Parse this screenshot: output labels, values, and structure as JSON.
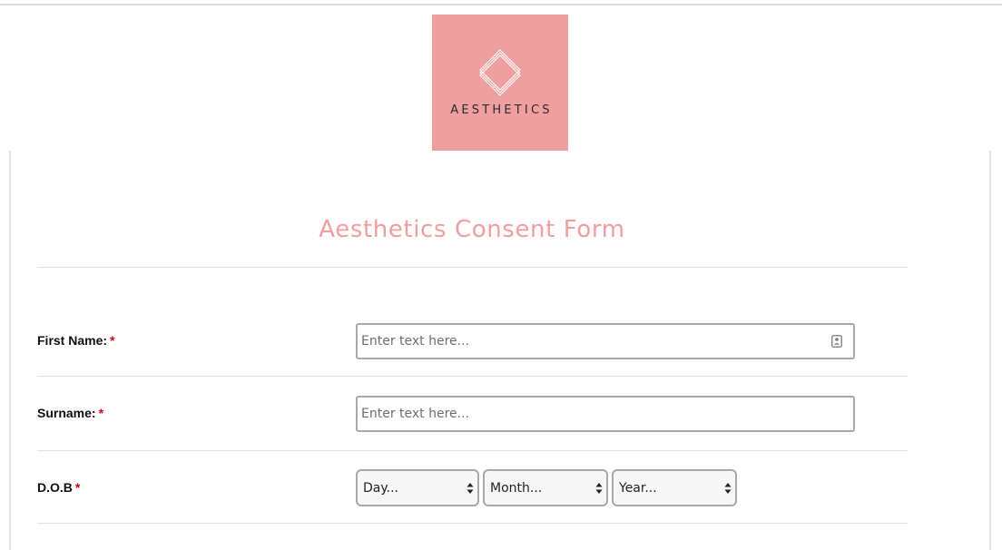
{
  "logo": {
    "text": "AESTHETICS",
    "background": "#ef9fa0",
    "icon": "nested-diamond-icon"
  },
  "form": {
    "title": "Aesthetics Consent Form",
    "title_color": "#ef9fa0",
    "required_marker": "*",
    "required_color": "#d0021b",
    "fields": {
      "first_name": {
        "label": "First Name:",
        "placeholder": "Enter text here...",
        "value": "",
        "icon": "contact-card-icon"
      },
      "surname": {
        "label": "Surname:",
        "placeholder": "Enter text here...",
        "value": ""
      },
      "dob": {
        "label": "D.O.B",
        "day": "Day...",
        "month": "Month...",
        "year": "Year..."
      }
    }
  }
}
